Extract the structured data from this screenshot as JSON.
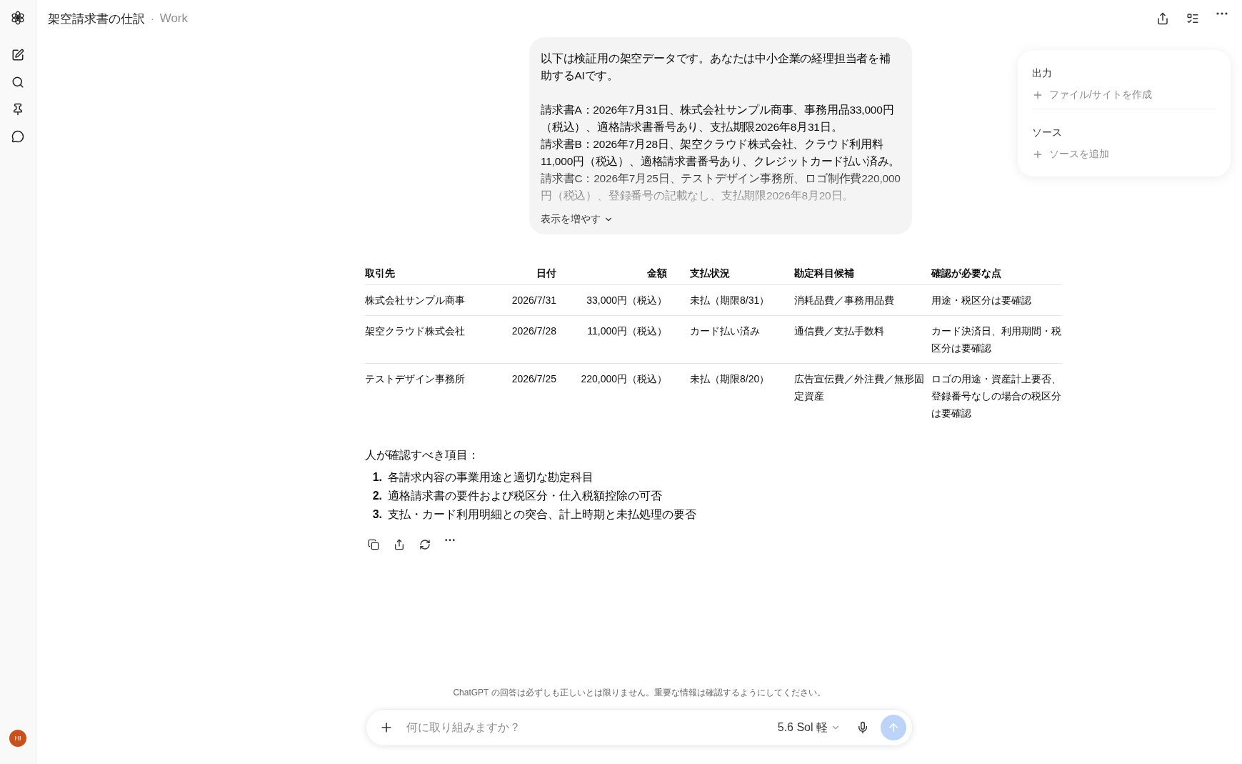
{
  "header": {
    "title": "架空請求書の仕訳",
    "separator": "·",
    "project": "Work"
  },
  "sidebar": {
    "avatar": "HI"
  },
  "user_message": {
    "intro": "以下は検証用の架空データです。あなたは中小企業の経理担当者を補助するAIです。",
    "paragraphs": [
      "請求書A：2026年7月31日、株式会社サンプル商事、事務用品33,000円（税込）、適格請求書番号あり、支払期限2026年8月31日。",
      "請求書B：2026年7月28日、架空クラウド株式会社、クラウド利用料11,000円（税込）、適格請求書番号あり、クレジットカード払い済み。",
      "請求書C：2026年7月25日、テストデザイン事務所、ロゴ制作費220,000円（税込）、登録番号の記載なし、支払期限2026年8月20日。"
    ],
    "show_more": "表示を増やす"
  },
  "table": {
    "columns": [
      "取引先",
      "日付",
      "金額",
      "支払状況",
      "勘定科目候補",
      "確認が必要な点"
    ],
    "rows": [
      [
        "株式会社サンプル商事",
        "2026/7/31",
        "33,000円（税込）",
        "未払（期限8/31）",
        "消耗品費／事務用品費",
        "用途・税区分は要確認"
      ],
      [
        "架空クラウド株式会社",
        "2026/7/28",
        "11,000円（税込）",
        "カード払い済み",
        "通信費／支払手数料",
        "カード決済日、利用期間・税区分は要確認"
      ],
      [
        "テストデザイン事務所",
        "2026/7/25",
        "220,000円（税込）",
        "未払（期限8/20）",
        "広告宣伝費／外注費／無形固定資産",
        "ロゴの用途・資産計上要否、登録番号なしの場合の税区分は要確認"
      ]
    ]
  },
  "checklist": {
    "heading": "人が確認すべき項目：",
    "items": [
      {
        "number": "1.",
        "text": "各請求内容の事業用途と適切な勘定科目"
      },
      {
        "number": "2.",
        "text": "適格請求書の要件および税区分・仕入税額控除の可否"
      },
      {
        "number": "3.",
        "text": "支払・カード利用明細との突合、計上時期と未払処理の要否"
      }
    ]
  },
  "side_panel": {
    "sections": [
      {
        "title": "出力",
        "action": "ファイル/サイトを作成"
      },
      {
        "title": "ソース",
        "action": "ソースを追加"
      }
    ]
  },
  "disclaimer": "ChatGPT の回答は必ずしも正しいとは限りません。重要な情報は確認するようにしてください。",
  "composer": {
    "placeholder": "何に取り組みますか？",
    "model": "5.6 Sol 軽"
  }
}
